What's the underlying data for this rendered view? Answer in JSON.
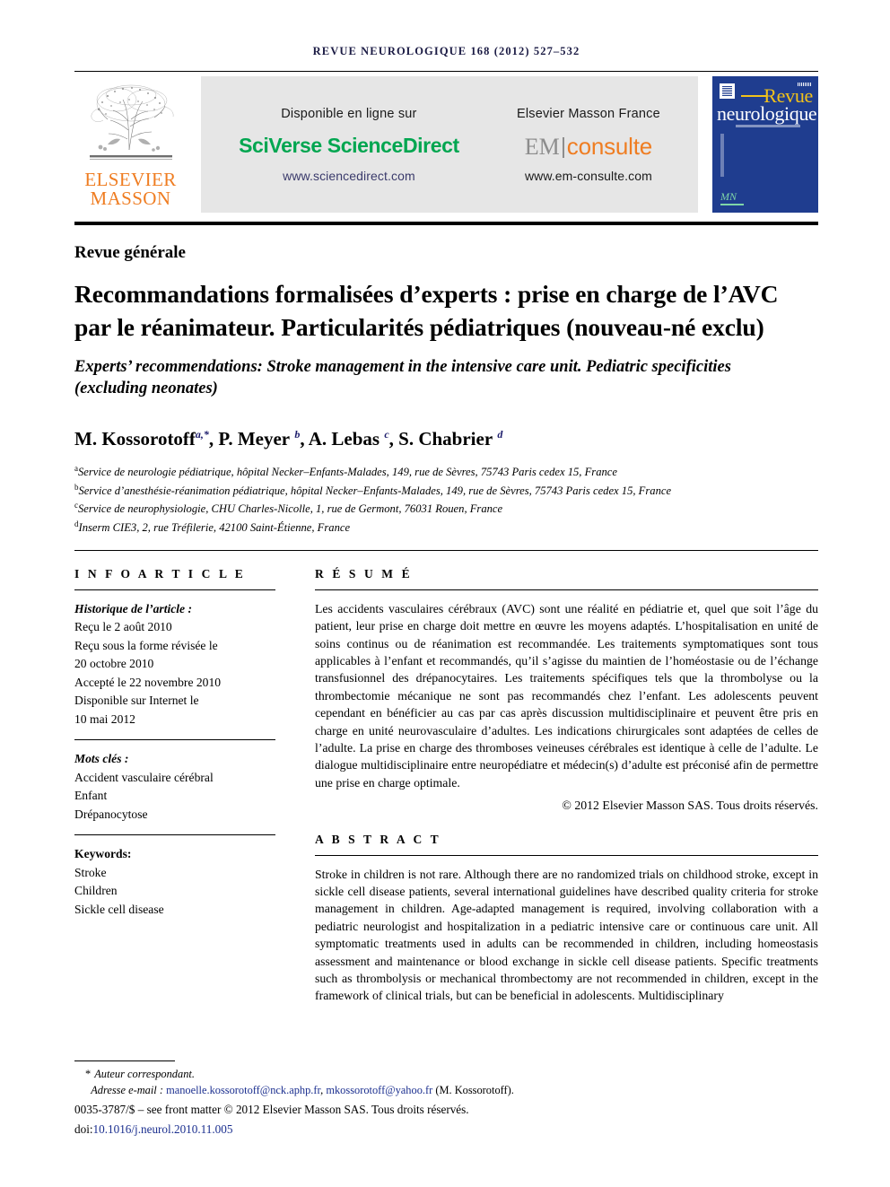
{
  "running_head": "REVUE NEUROLOGIQUE 168 (2012) 527–532",
  "masthead": {
    "elsevier": {
      "line1": "ELSEVIER",
      "line2": "MASSON",
      "logo_icon": "elsevier-tree-icon",
      "color": "#ef7d22"
    },
    "banner": {
      "left": {
        "top_label": "Disponible en ligne sur",
        "logo": "SciVerse ScienceDirect",
        "logo_color": "#00a650",
        "url": "www.sciencedirect.com"
      },
      "right": {
        "top_label": "Elsevier Masson France",
        "logo_em": "EM",
        "logo_consulte": "consulte",
        "logo_em_color": "#8d8d8d",
        "logo_consulte_color": "#ef7d22",
        "url": "www.em-consulte.com"
      }
    },
    "journal_cover": {
      "title_line1": "Revue",
      "title_line2": "neurologique",
      "bg_color": "#1f3d8f",
      "title1_color": "#f2c21a",
      "title2_color": "#ffffff",
      "mark": "MN"
    }
  },
  "article": {
    "section_label": "Revue générale",
    "title_fr": "Recommandations formalisées d’experts : prise en charge de l’AVC par le réanimateur. Particularités pédiatriques (nouveau-né exclu)",
    "title_en": "Experts’ recommendations: Stroke management in the intensive care unit. Pediatric specificities (excluding neonates)",
    "authors": [
      {
        "name": "M. Kossorotoff",
        "marks": "a,*"
      },
      {
        "name": "P. Meyer",
        "marks": "b"
      },
      {
        "name": "A. Lebas",
        "marks": "c"
      },
      {
        "name": "S. Chabrier",
        "marks": "d"
      }
    ],
    "affiliations": [
      {
        "mark": "a",
        "text": "Service de neurologie pédiatrique, hôpital Necker–Enfants-Malades, 149, rue de Sèvres, 75743 Paris cedex 15, France"
      },
      {
        "mark": "b",
        "text": "Service d’anesthésie-réanimation pédiatrique, hôpital Necker–Enfants-Malades, 149, rue de Sèvres, 75743 Paris cedex 15, France"
      },
      {
        "mark": "c",
        "text": "Service de neurophysiologie, CHU Charles-Nicolle, 1, rue de Germont, 76031 Rouen, France"
      },
      {
        "mark": "d",
        "text": "Inserm CIE3, 2, rue Tréfilerie, 42100 Saint-Étienne, France"
      }
    ]
  },
  "info_article": {
    "heading": "I N F O   A R T I C L E",
    "history_label": "Historique de l’article :",
    "history_lines": [
      "Reçu le 2 août 2010",
      "Reçu sous la forme révisée le",
      "20 octobre 2010",
      "Accepté le 22 novembre 2010",
      "Disponible sur Internet le",
      "10 mai 2012"
    ],
    "keywords_fr_label": "Mots clés :",
    "keywords_fr": [
      "Accident vasculaire cérébral",
      "Enfant",
      "Drépanocytose"
    ],
    "keywords_en_label": "Keywords:",
    "keywords_en": [
      "Stroke",
      "Children",
      "Sickle cell disease"
    ]
  },
  "resume": {
    "heading": "R É S U M É",
    "text": "Les accidents vasculaires cérébraux (AVC) sont une réalité en pédiatrie et, quel que soit l’âge du patient, leur prise en charge doit mettre en œuvre les moyens adaptés. L’hospitalisation en unité de soins continus ou de réanimation est recommandée. Les traitements symptomatiques sont tous applicables à l’enfant et recommandés, qu’il s’agisse du maintien de l’homéostasie ou de l’échange transfusionnel des drépanocytaires. Les traitements spécifiques tels que la thrombolyse ou la thrombectomie mécanique ne sont pas recommandés chez l’enfant. Les adolescents peuvent cependant en bénéficier au cas par cas après discussion multidisciplinaire et peuvent être pris en charge en unité neurovasculaire d’adultes. Les indications chirurgicales sont adaptées de celles de l’adulte. La prise en charge des thromboses veineuses cérébrales est identique à celle de l’adulte. Le dialogue multidisciplinaire entre neuropédiatre et médecin(s) d’adulte est préconisé afin de permettre une prise en charge optimale.",
    "copyright": "© 2012 Elsevier Masson SAS. Tous droits réservés."
  },
  "abstract": {
    "heading": "A B S T R A C T",
    "text": "Stroke in children is not rare. Although there are no randomized trials on childhood stroke, except in sickle cell disease patients, several international guidelines have described quality criteria for stroke management in children. Age-adapted management is required, involving collaboration with a pediatric neurologist and hospitalization in a pediatric intensive care or continuous care unit. All symptomatic treatments used in adults can be recommended in children, including homeostasis assessment and maintenance or blood exchange in sickle cell disease patients. Specific treatments such as thrombolysis or mechanical thrombectomy are not recommended in children, except in the framework of clinical trials, but can be beneficial in adolescents. Multidisciplinary"
  },
  "footer": {
    "corresponding_marker": "*",
    "corresponding_label": "Auteur correspondant.",
    "email_label": "Adresse e-mail :",
    "email_1": "manoelle.kossorotoff@nck.aphp.fr",
    "email_sep": ", ",
    "email_2": "mkossorotoff@yahoo.fr",
    "email_attrib": "(M. Kossorotoff).",
    "issn_line": "0035-3787/$ – see front matter © 2012 Elsevier Masson SAS. Tous droits réservés.",
    "doi_prefix": "doi:",
    "doi": "10.1016/j.neurol.2010.11.005"
  }
}
